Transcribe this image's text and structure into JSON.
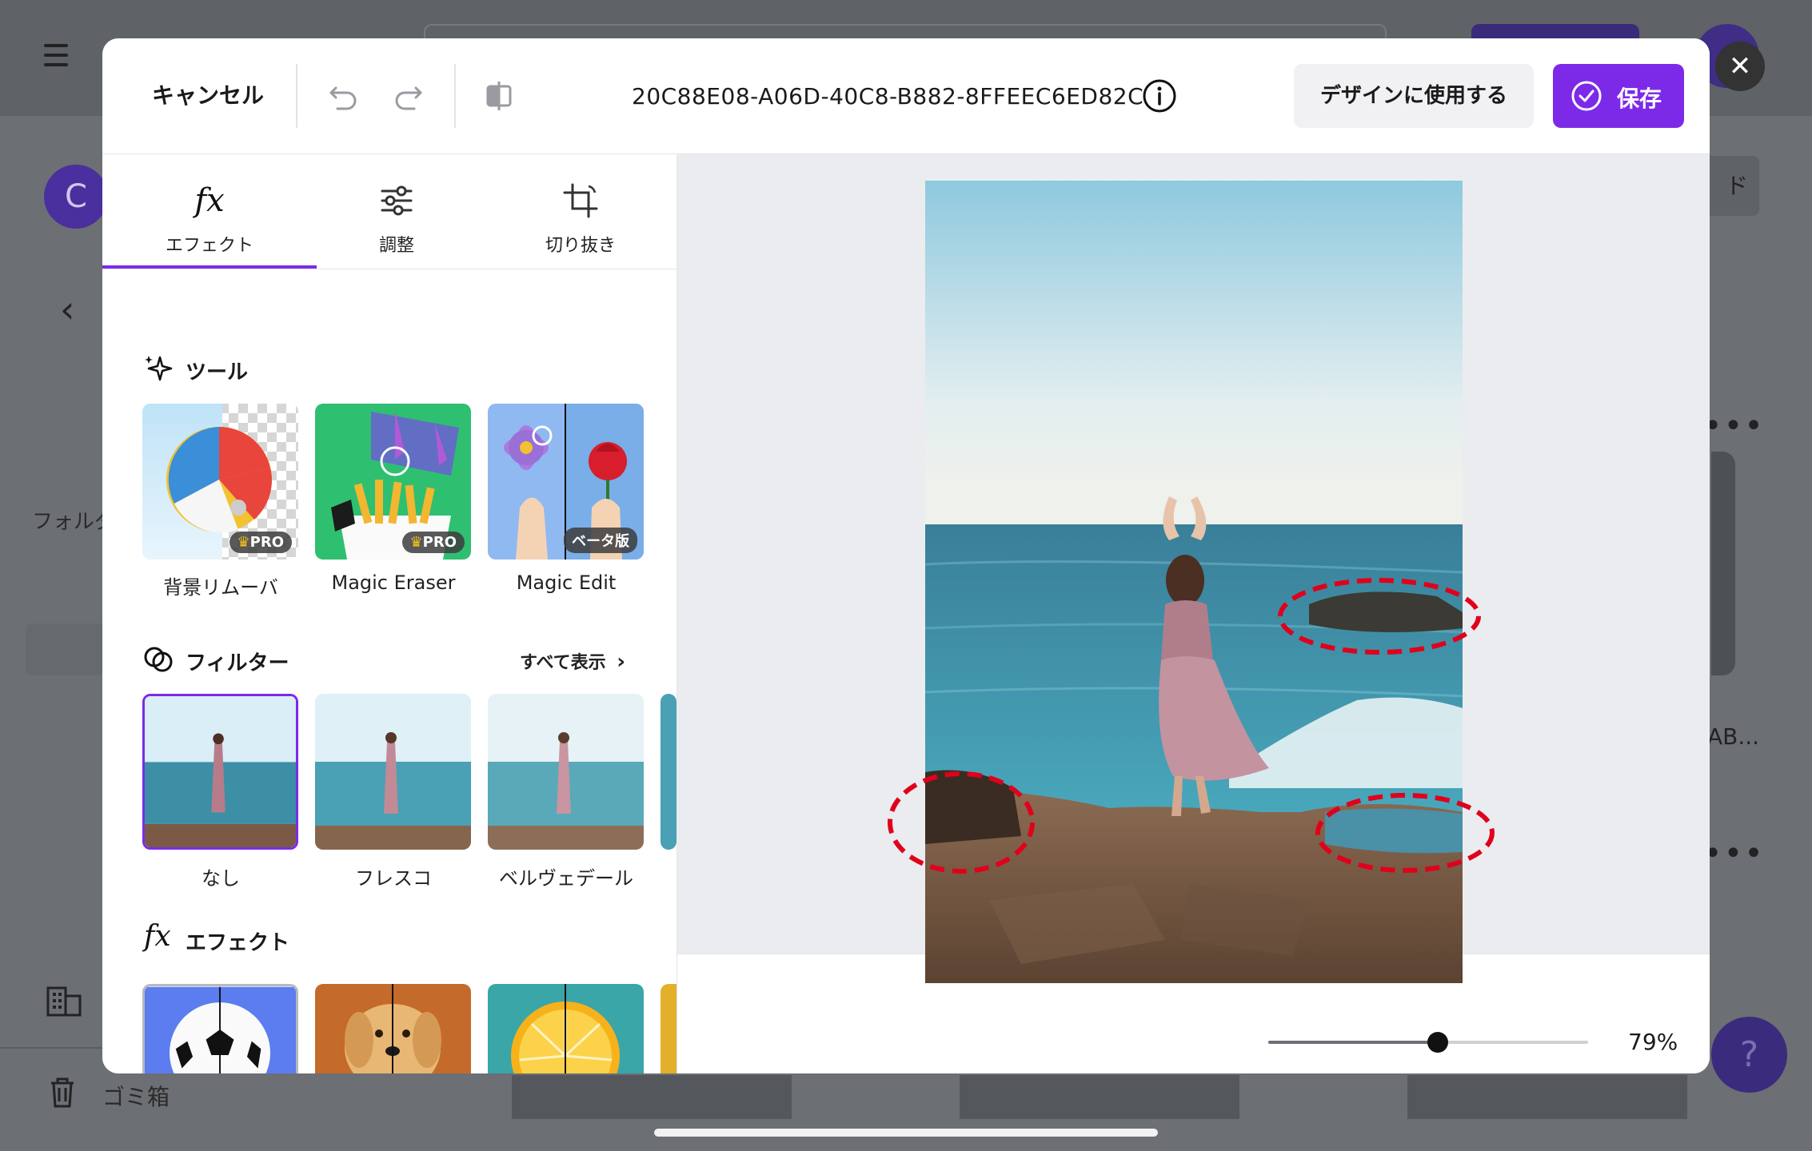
{
  "background_app": {
    "avatar_letter": "C",
    "folder_text": "フォルダ",
    "trash_label": "ゴミ箱",
    "right_chip_text": "ド",
    "right_card_text": "AB...",
    "help_glyph": "?",
    "more_dots": "•••"
  },
  "editor": {
    "cancel_label": "キャンセル",
    "filename": "20C88E08-A06D-40C8-B882-8FFEEC6ED82C",
    "use_in_design_label": "デザインに使用する",
    "save_label": "保存",
    "close_glyph": "✕",
    "tabs": [
      {
        "label": "エフェクト",
        "icon": "fx-icon",
        "active": true
      },
      {
        "label": "調整",
        "icon": "sliders-icon",
        "active": false
      },
      {
        "label": "切り抜き",
        "icon": "crop-icon",
        "active": false
      }
    ],
    "tools_section": {
      "title": "ツール",
      "items": [
        {
          "label": "背景リムーバ",
          "badge": "PRO"
        },
        {
          "label": "Magic Eraser",
          "badge": "PRO"
        },
        {
          "label": "Magic Edit",
          "badge": "ベータ版"
        }
      ]
    },
    "filters_section": {
      "title": "フィルター",
      "see_all_label": "すべて表示",
      "items": [
        {
          "label": "なし",
          "selected": true
        },
        {
          "label": "フレスコ",
          "selected": false
        },
        {
          "label": "ベルヴェデール",
          "selected": false
        }
      ]
    },
    "effects_section": {
      "title": "エフェクト"
    },
    "fx_glyph": "fx",
    "zoom": {
      "value_label": "79%",
      "level": 0.53
    },
    "colors": {
      "accent": "#7d2ae8",
      "annotation": "#e0001b"
    }
  }
}
